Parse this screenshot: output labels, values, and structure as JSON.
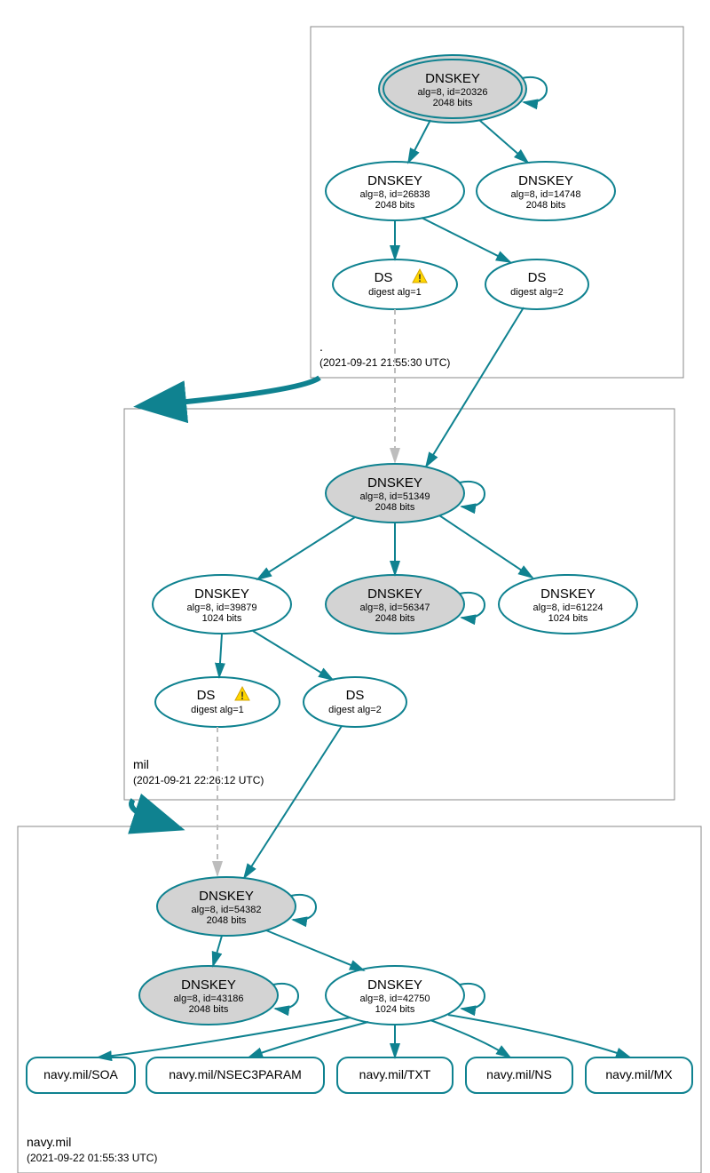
{
  "teal": "#0f8290",
  "gray": "#d3d3d3",
  "lightgray": "#bdbdbd",
  "zones": {
    "root": {
      "label": ".",
      "time": "(2021-09-21 21:55:30 UTC)"
    },
    "mil": {
      "label": "mil",
      "time": "(2021-09-21 22:26:12 UTC)"
    },
    "navy": {
      "label": "navy.mil",
      "time": "(2021-09-22 01:55:33 UTC)"
    }
  },
  "nodes": {
    "root_ksk": {
      "title": "DNSKEY",
      "l2": "alg=8, id=20326",
      "l3": "2048 bits"
    },
    "root_zsk1": {
      "title": "DNSKEY",
      "l2": "alg=8, id=26838",
      "l3": "2048 bits"
    },
    "root_zsk2": {
      "title": "DNSKEY",
      "l2": "alg=8, id=14748",
      "l3": "2048 bits"
    },
    "root_ds1": {
      "title": "DS",
      "l2": "digest alg=1"
    },
    "root_ds2": {
      "title": "DS",
      "l2": "digest alg=2"
    },
    "mil_ksk": {
      "title": "DNSKEY",
      "l2": "alg=8, id=51349",
      "l3": "2048 bits"
    },
    "mil_zsk1": {
      "title": "DNSKEY",
      "l2": "alg=8, id=39879",
      "l3": "1024 bits"
    },
    "mil_zsk2": {
      "title": "DNSKEY",
      "l2": "alg=8, id=56347",
      "l3": "2048 bits"
    },
    "mil_zsk3": {
      "title": "DNSKEY",
      "l2": "alg=8, id=61224",
      "l3": "1024 bits"
    },
    "mil_ds1": {
      "title": "DS",
      "l2": "digest alg=1"
    },
    "mil_ds2": {
      "title": "DS",
      "l2": "digest alg=2"
    },
    "navy_ksk": {
      "title": "DNSKEY",
      "l2": "alg=8, id=54382",
      "l3": "2048 bits"
    },
    "navy_zsk1": {
      "title": "DNSKEY",
      "l2": "alg=8, id=43186",
      "l3": "2048 bits"
    },
    "navy_zsk2": {
      "title": "DNSKEY",
      "l2": "alg=8, id=42750",
      "l3": "1024 bits"
    }
  },
  "rr": {
    "soa": "navy.mil/SOA",
    "n3p": "navy.mil/NSEC3PARAM",
    "txt": "navy.mil/TXT",
    "ns": "navy.mil/NS",
    "mx": "navy.mil/MX"
  }
}
